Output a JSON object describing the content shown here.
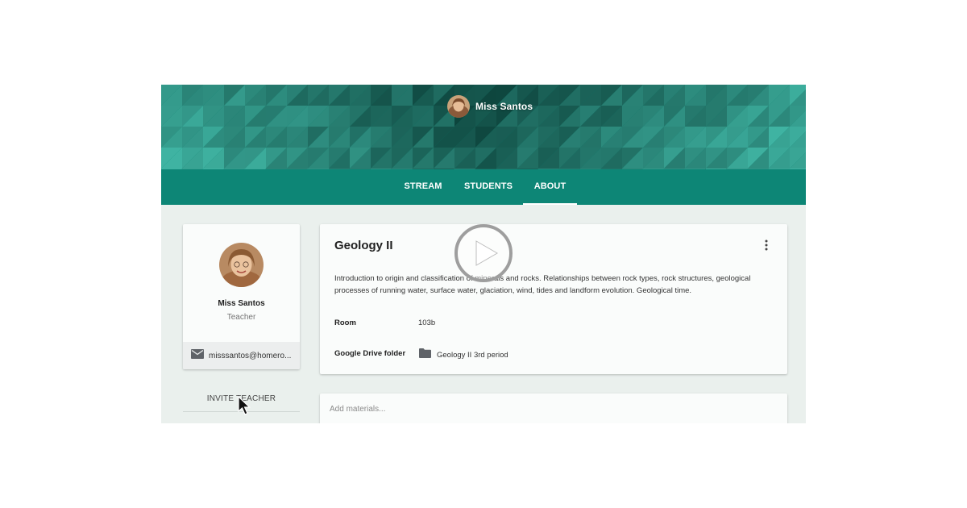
{
  "banner": {
    "teacher_name": "Miss Santos",
    "colors": {
      "base": "#00796b",
      "dark": "#0a3d36",
      "light": "#3fb3a2"
    }
  },
  "tabs": [
    {
      "label": "STREAM",
      "active": false
    },
    {
      "label": "STUDENTS",
      "active": false
    },
    {
      "label": "ABOUT",
      "active": true
    }
  ],
  "profile": {
    "name": "Miss Santos",
    "role": "Teacher",
    "email": "misssantos@homero...",
    "invite_label": "INVITE TEACHER"
  },
  "course": {
    "title": "Geology II",
    "description": "Introduction to origin and classification of minerals and rocks. Relationships between rock types, rock structures, geological processes of running water, surface water, glaciation, wind, tides and landform evolution. Geological time.",
    "room_label": "Room",
    "room_value": "103b",
    "drive_label": "Google Drive folder",
    "drive_value": "Geology II 3rd period"
  },
  "materials": {
    "placeholder": "Add materials..."
  },
  "icons": {
    "more": "more-vert-icon",
    "mail": "mail-icon",
    "folder": "folder-icon",
    "play": "play-icon",
    "cursor": "mouse-pointer-icon"
  }
}
